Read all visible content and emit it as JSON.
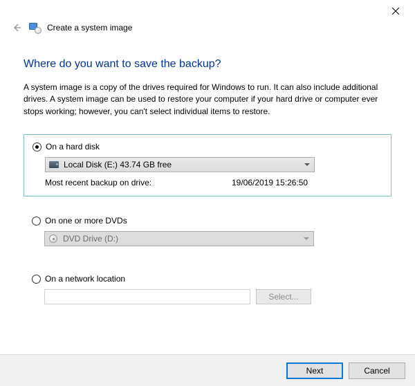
{
  "window": {
    "title": "Create a system image"
  },
  "heading": "Where do you want to save the backup?",
  "description": "A system image is a copy of the drives required for Windows to run. It can also include additional drives. A system image can be used to restore your computer if your hard drive or computer ever stops working; however, you can't select individual items to restore.",
  "options": {
    "hard_disk": {
      "label": "On a hard disk",
      "selected_drive": "Local Disk (E:)  43.74 GB free",
      "recent_label": "Most recent backup on drive:",
      "recent_value": "19/06/2019 15:26:50"
    },
    "dvd": {
      "label": "On one or more DVDs",
      "selected_drive": "DVD Drive (D:)"
    },
    "network": {
      "label": "On a network location",
      "select_button": "Select..."
    }
  },
  "buttons": {
    "next": "Next",
    "cancel": "Cancel"
  }
}
